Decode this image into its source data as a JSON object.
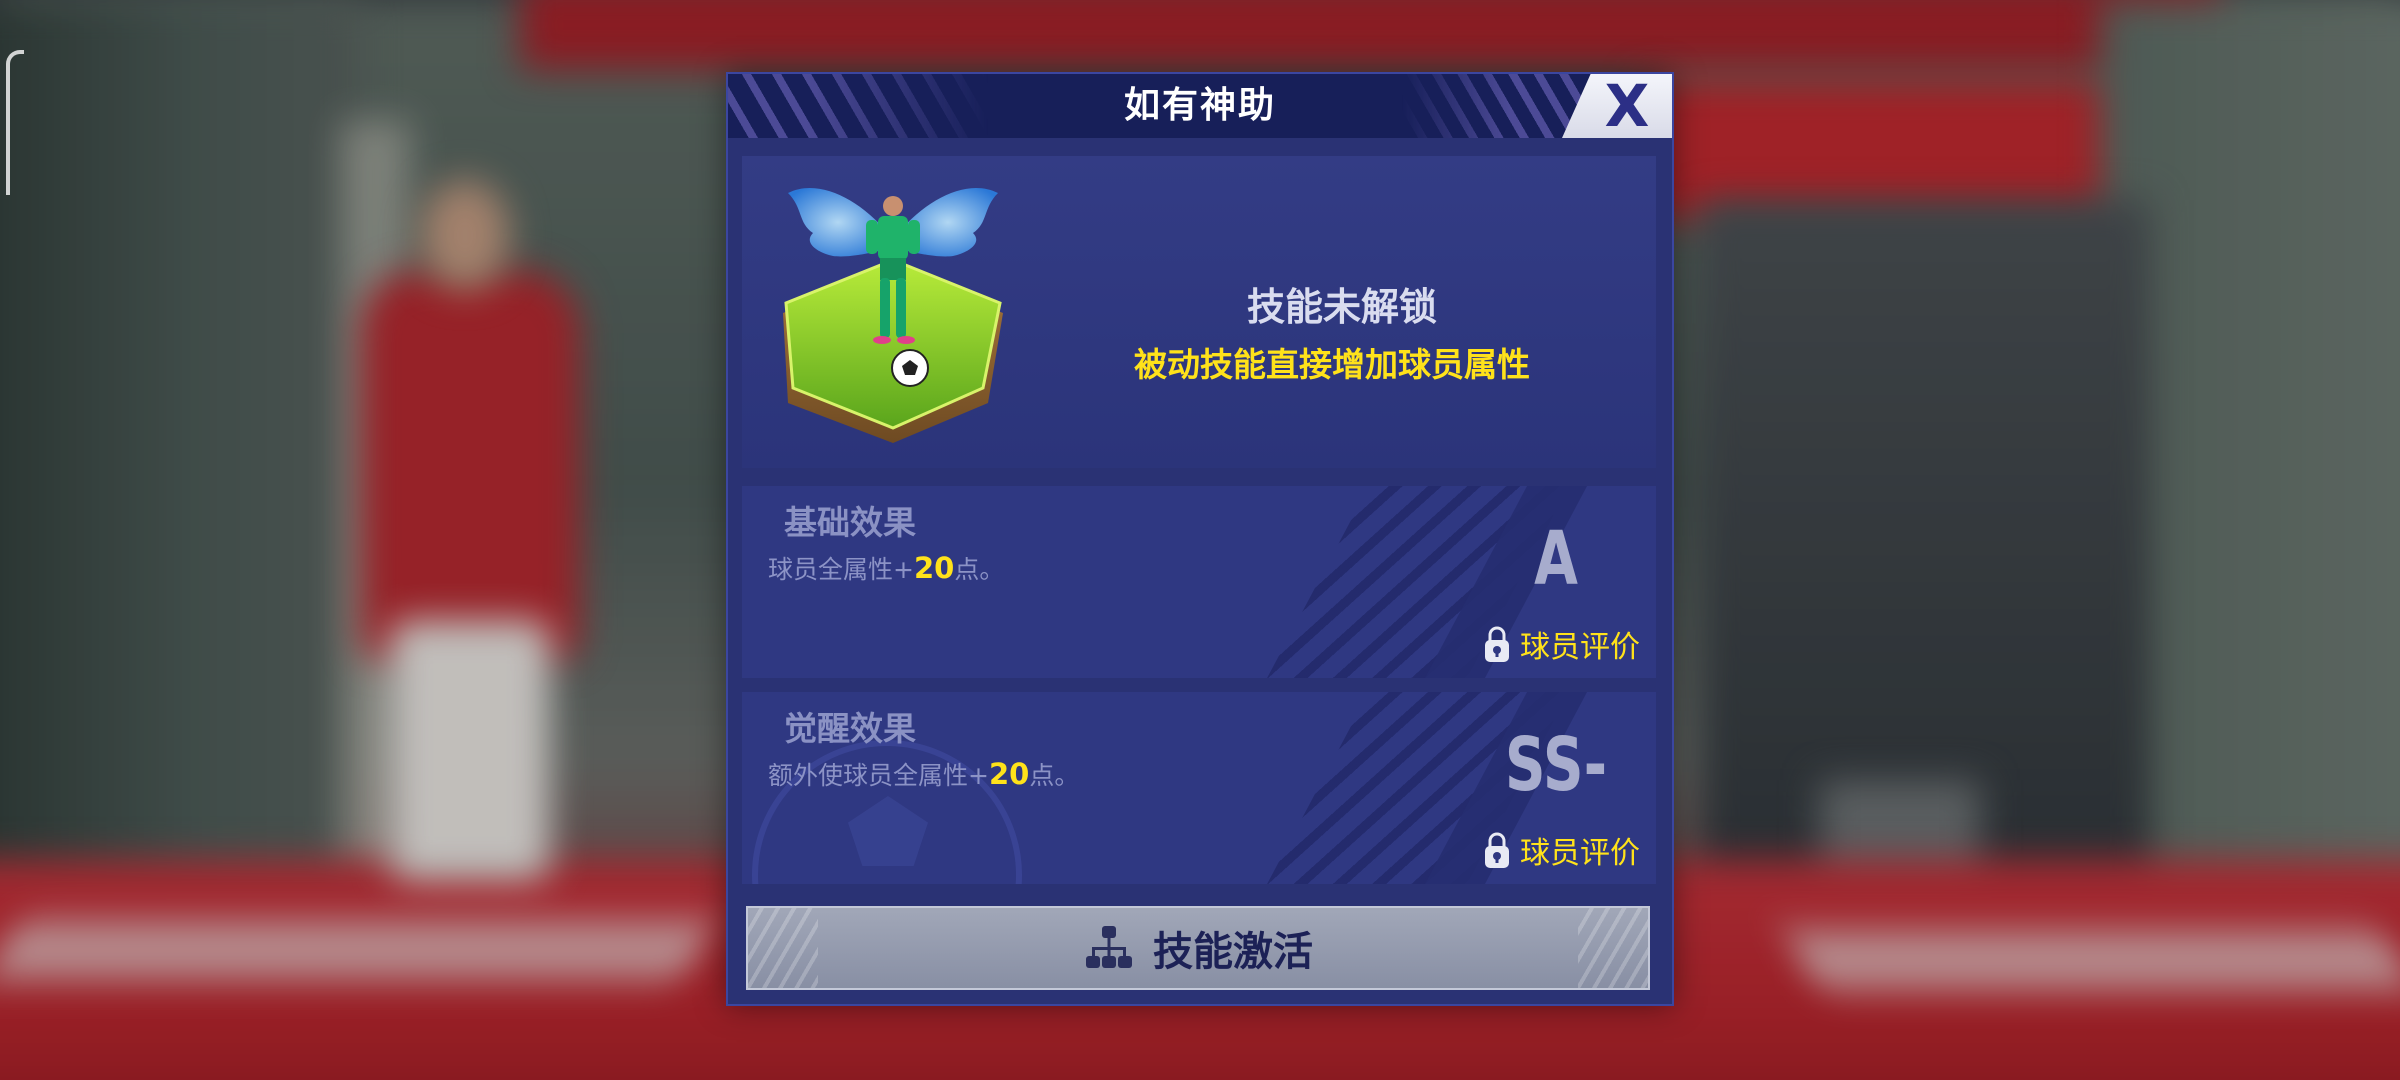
{
  "dialog": {
    "title": "如有神助",
    "close_label": "X"
  },
  "skill": {
    "icon": "winged-player-on-hex-pitch",
    "status_title": "技能未解锁",
    "status_desc": "被动技能直接增加球员属性"
  },
  "effects": {
    "base": {
      "title": "基础效果",
      "text_prefix": "球员全属性+",
      "value": "20",
      "text_suffix": "点。",
      "grade": "A",
      "rating_label": "球员评价",
      "lock_icon": "lock-icon"
    },
    "awaken": {
      "title": "觉醒效果",
      "text_prefix": "额外使球员全属性+",
      "value": "20",
      "text_suffix": "点。",
      "grade": "SS-",
      "rating_label": "球员评价",
      "lock_icon": "lock-icon"
    }
  },
  "activate": {
    "label": "技能激活",
    "icon": "skill-tree-icon"
  },
  "colors": {
    "dialog_bg": "#2a3274",
    "title_bg": "#171f59",
    "accent_yellow": "#ffe21a",
    "button_bg": "#959bb0"
  }
}
